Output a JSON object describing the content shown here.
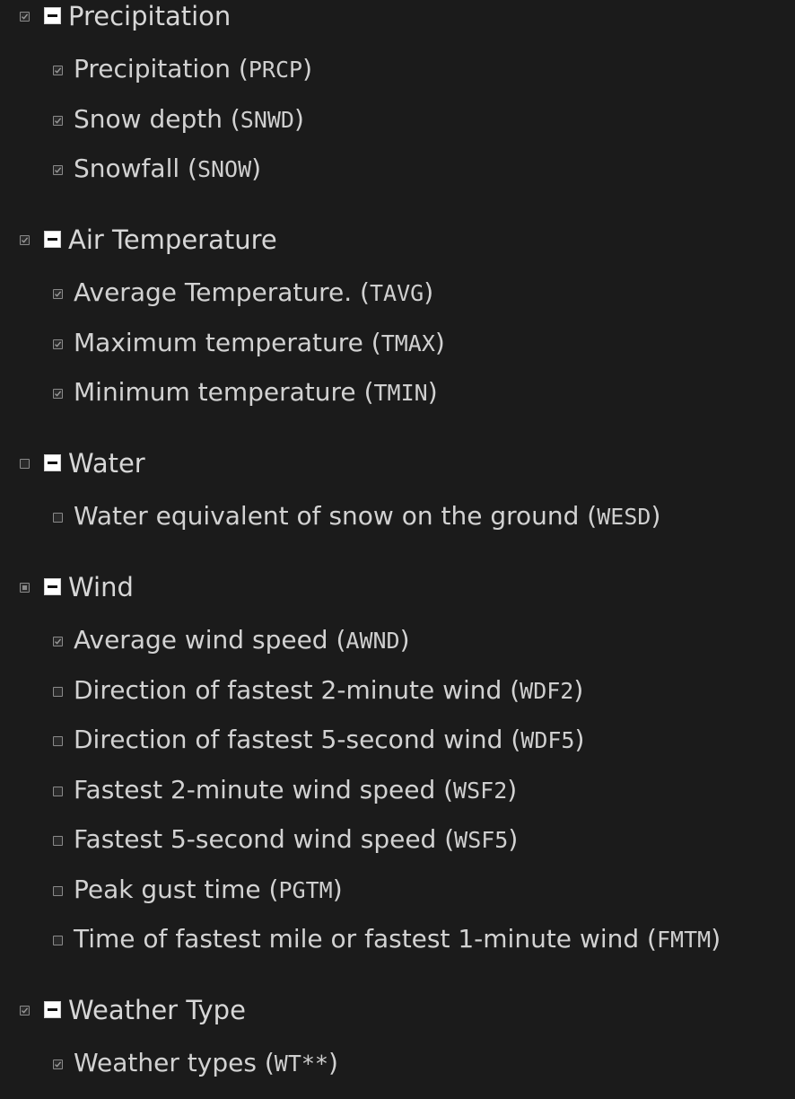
{
  "groups": [
    {
      "label": "Precipitation",
      "state": "checked",
      "items": [
        {
          "label": "Precipitation",
          "code": "PRCP",
          "checked": true
        },
        {
          "label": "Snow depth",
          "code": "SNWD",
          "checked": true
        },
        {
          "label": "Snowfall",
          "code": "SNOW",
          "checked": true
        }
      ]
    },
    {
      "label": "Air Temperature",
      "state": "checked",
      "items": [
        {
          "label": "Average Temperature.",
          "code": "TAVG",
          "checked": true
        },
        {
          "label": "Maximum temperature",
          "code": "TMAX",
          "checked": true
        },
        {
          "label": "Minimum temperature",
          "code": "TMIN",
          "checked": true
        }
      ]
    },
    {
      "label": "Water",
      "state": "unchecked",
      "items": [
        {
          "label": "Water equivalent of snow on the ground",
          "code": "WESD",
          "checked": false
        }
      ]
    },
    {
      "label": "Wind",
      "state": "partial",
      "items": [
        {
          "label": "Average wind speed",
          "code": "AWND",
          "checked": true
        },
        {
          "label": "Direction of fastest 2-minute wind",
          "code": "WDF2",
          "checked": false
        },
        {
          "label": "Direction of fastest 5-second wind",
          "code": "WDF5",
          "checked": false
        },
        {
          "label": "Fastest 2-minute wind speed",
          "code": "WSF2",
          "checked": false
        },
        {
          "label": "Fastest 5-second wind speed",
          "code": "WSF5",
          "checked": false
        },
        {
          "label": "Peak gust time",
          "code": "PGTM",
          "checked": false
        },
        {
          "label": "Time of fastest mile or fastest 1-minute wind",
          "code": "FMTM",
          "checked": false
        }
      ]
    },
    {
      "label": "Weather Type",
      "state": "checked",
      "items": [
        {
          "label": "Weather types",
          "code": "WT**",
          "checked": true
        }
      ]
    }
  ]
}
